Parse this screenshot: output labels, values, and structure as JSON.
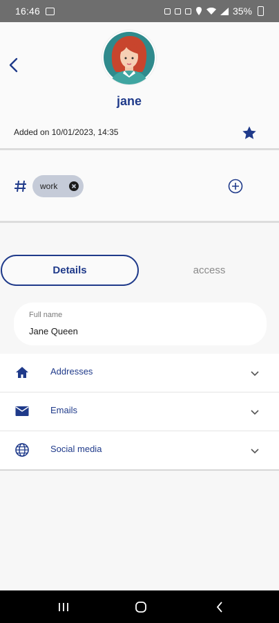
{
  "status_bar": {
    "time": "16:46",
    "icons": [
      "image-icon",
      "alarm-icon",
      "vibrate-icon",
      "mute-icon",
      "location-icon",
      "wifi-icon",
      "signal-icon",
      "battery-icon"
    ],
    "battery": "35%"
  },
  "contact": {
    "name": "jane",
    "added_on": "Added on 10/01/2023, 14:35",
    "favorite": true
  },
  "tags": {
    "items": [
      {
        "label": "work"
      }
    ]
  },
  "tabs": [
    {
      "label": "Details",
      "active": true
    },
    {
      "label": "access",
      "active": false
    }
  ],
  "full_name": {
    "label": "Full name",
    "value": "Jane Queen"
  },
  "sections": [
    {
      "label": "Addresses",
      "icon": "home-icon"
    },
    {
      "label": "Emails",
      "icon": "mail-icon"
    },
    {
      "label": "Social media",
      "icon": "globe-icon"
    }
  ],
  "nav": {
    "buttons": [
      "recent-apps-icon",
      "home-circle-icon",
      "back-icon"
    ]
  },
  "colors": {
    "accent": "#1f3a8a",
    "chip": "#c5cbd8",
    "background": "#f7f7f7"
  }
}
